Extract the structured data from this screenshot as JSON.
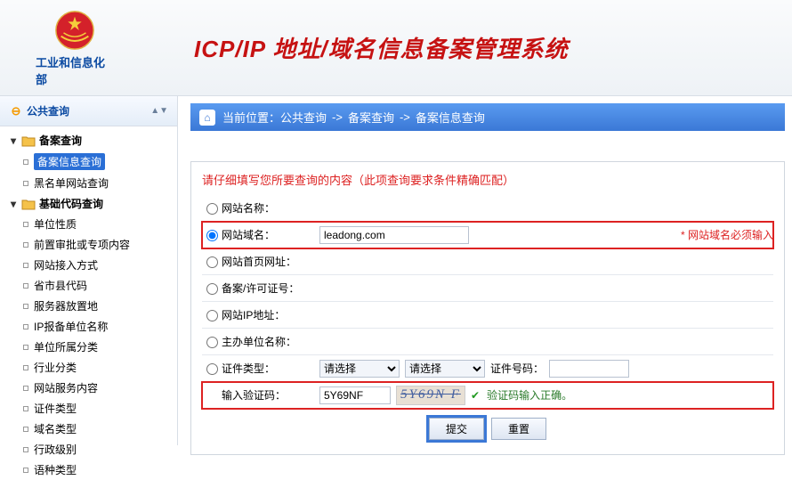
{
  "header": {
    "ministry_label": "工业和信息化部",
    "system_title": "ICP/IP 地址/域名信息备案管理系统"
  },
  "sidebar": {
    "section_title": "公共查询",
    "groups": [
      {
        "label": "备案查询",
        "items": [
          {
            "label": "备案信息查询",
            "selected": true
          },
          {
            "label": "黑名单网站查询",
            "selected": false
          }
        ]
      },
      {
        "label": "基础代码查询",
        "items": [
          {
            "label": "单位性质"
          },
          {
            "label": "前置审批或专项内容"
          },
          {
            "label": "网站接入方式"
          },
          {
            "label": "省市县代码"
          },
          {
            "label": "服务器放置地"
          },
          {
            "label": "IP报备单位名称"
          },
          {
            "label": "单位所属分类"
          },
          {
            "label": "行业分类"
          },
          {
            "label": "网站服务内容"
          },
          {
            "label": "证件类型"
          },
          {
            "label": "域名类型"
          },
          {
            "label": "行政级别"
          },
          {
            "label": "语种类型"
          }
        ]
      }
    ]
  },
  "breadcrumb": {
    "prefix": "当前位置：",
    "items": [
      "公共查询",
      "备案查询",
      "备案信息查询"
    ],
    "sep": "->"
  },
  "form": {
    "instruction": "请仔细填写您所要查询的内容（此项查询要求条件精确匹配）",
    "rows": [
      {
        "key": "site_name",
        "label": "网站名称：",
        "value": ""
      },
      {
        "key": "site_domain",
        "label": "网站域名：",
        "value": "leadong.com",
        "required_msg": "* 网站域名必须输入",
        "checked": true,
        "highlight": true
      },
      {
        "key": "site_homepage",
        "label": "网站首页网址：",
        "value": ""
      },
      {
        "key": "license_no",
        "label": "备案/许可证号：",
        "value": ""
      },
      {
        "key": "site_ip",
        "label": "网站IP地址：",
        "value": ""
      },
      {
        "key": "sponsor_name",
        "label": "主办单位名称：",
        "value": ""
      }
    ],
    "cert_row": {
      "label": "证件类型：",
      "select1_placeholder": "请选择",
      "select2_placeholder": "请选择",
      "cert_no_label": "证件号码：",
      "cert_no_value": ""
    },
    "captcha_row": {
      "label": "输入验证码：",
      "value": "5Y69NF",
      "captcha_image_text": "5Y69N F",
      "ok_msg": "验证码输入正确。",
      "highlight": true
    },
    "actions": {
      "submit_label": "提交",
      "reset_label": "重置"
    }
  }
}
